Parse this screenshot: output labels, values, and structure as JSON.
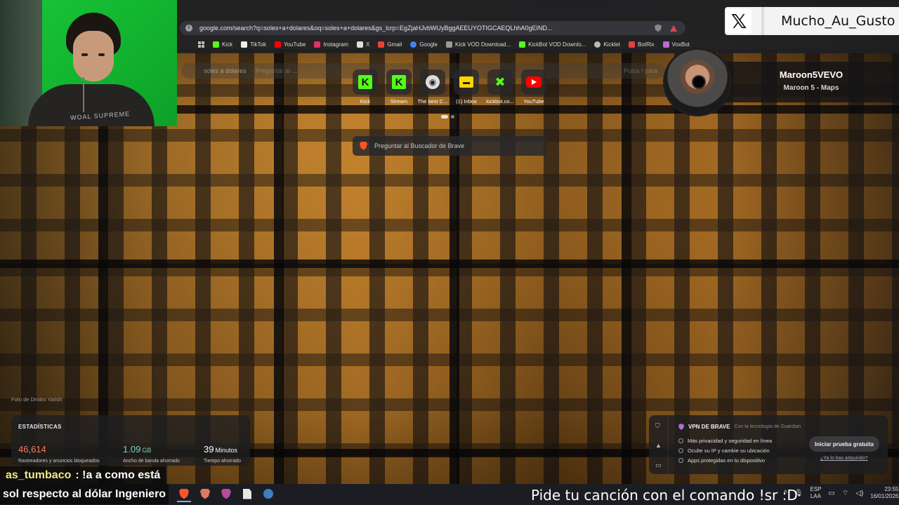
{
  "browser": {
    "url": "google.com/search?q=soles+a+dolares&oq=soles+a+dolares&gs_lcrp=EgZjaHJvbWUyBggAEEUYOTIGCAEQLhhA0gEIND...",
    "bookmarks": [
      {
        "label": "Kick",
        "icon": "kick-icon",
        "color": "#53fc18"
      },
      {
        "label": "TikTok",
        "icon": "tiktok-icon",
        "color": "#ffffff"
      },
      {
        "label": "YouTube",
        "icon": "youtube-icon",
        "color": "#ff0000"
      },
      {
        "label": "Instagram",
        "icon": "instagram-icon",
        "color": "#e1306c"
      },
      {
        "label": "X",
        "icon": "x-icon",
        "color": "#ffffff"
      },
      {
        "label": "Gmail",
        "icon": "gmail-icon",
        "color": "#ea4335"
      },
      {
        "label": "Google",
        "icon": "google-icon",
        "color": "#4285f4"
      },
      {
        "label": "Kick VOD Download...",
        "icon": "kick-vod-icon",
        "color": "#999999"
      },
      {
        "label": "KickBot VOD Downlo...",
        "icon": "kickbot-icon",
        "color": "#53fc18"
      },
      {
        "label": "Kicklet",
        "icon": "kicklet-icon",
        "color": "#bbbbbb"
      },
      {
        "label": "BotRix",
        "icon": "botrix-icon",
        "color": "#e64040"
      },
      {
        "label": "VoxBot",
        "icon": "voxbot-icon",
        "color": "#b86ad6"
      }
    ]
  },
  "ghost_search": {
    "query": "soles a dolares",
    "hint": "- Preguntar al ...",
    "right": "Pulsa / para"
  },
  "top_sites": [
    {
      "label": "Kick",
      "icon": "kick-icon"
    },
    {
      "label": "Stream",
      "icon": "kick-icon"
    },
    {
      "label": "The best C...",
      "icon": "github-icon"
    },
    {
      "label": "(1) Inbox",
      "icon": "inbox-icon"
    },
    {
      "label": "kickbot.co...",
      "icon": "kickbot-icon"
    },
    {
      "label": "YouTube",
      "icon": "youtube-icon"
    }
  ],
  "brave_search_placeholder": "Preguntar al Buscador de Brave",
  "photo_credit": "Foto de Dmitro Yarish",
  "stats": {
    "title": "ESTADÍSTICAS",
    "blocked_value": "46,614",
    "blocked_label": "Rastreadores y anuncios bloqueados",
    "bandwidth_value": "1.09",
    "bandwidth_unit": "GB",
    "bandwidth_label": "Ancho de banda ahorrado",
    "time_value": "39",
    "time_unit": "Minutos",
    "time_label": "Tiempo ahorrado",
    "colors": {
      "blocked": "#ff7a5c",
      "bandwidth": "#7fd4b0",
      "time": "#ffffff"
    }
  },
  "vpn": {
    "title": "VPN DE BRAVE",
    "powered_by": "Con la tecnología de Guardian",
    "features": [
      "Más privacidad y seguridad en línea",
      "Oculte su IP y cambie su ubicación",
      "Apps protegidas en tu dispositivo"
    ],
    "cta": "Iniciar prueba gratuita",
    "link": "¿Ya lo has adquirido?"
  },
  "social": {
    "handle": "Mucho_Au_Gusto",
    "icon": "x-logo-icon"
  },
  "now_playing": {
    "title": "Maroon5VEVO",
    "subtitle": "Maroon 5 - Maps"
  },
  "webcam": {
    "shirt_text": "WOAL SUPREME"
  },
  "chat": [
    {
      "user": "as_tumbaco",
      "message": ": !a a como está"
    },
    {
      "message": "sol respecto al dólar Ingeniero"
    }
  ],
  "overlay_banner": "Pide tu canción con el comando !sr :D",
  "tray": {
    "lang_top": "ESP",
    "lang_bottom": "LAA",
    "time": "23:55",
    "date": "16/01/2026"
  }
}
